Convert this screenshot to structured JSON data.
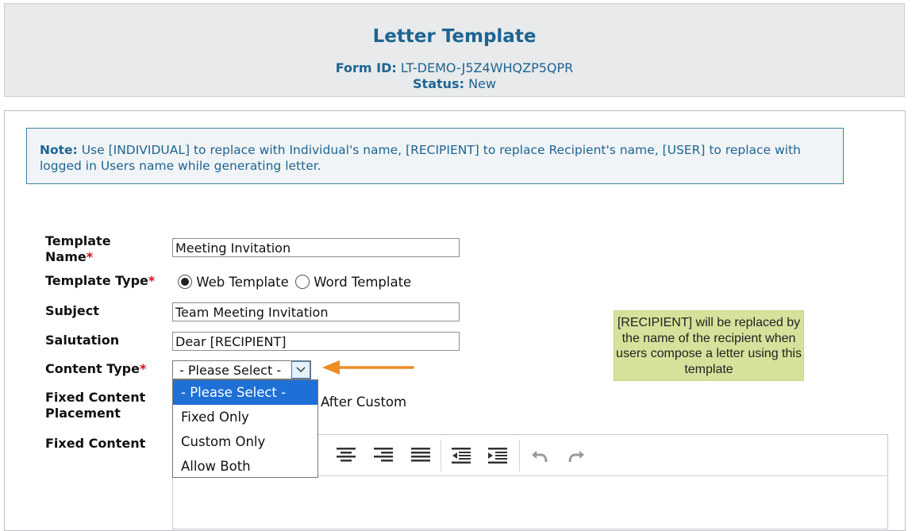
{
  "header": {
    "title": "Letter Template",
    "form_id_label": "Form ID:",
    "form_id_value": "LT-DEMO-J5Z4WHQZP5QPR",
    "status_label": "Status:",
    "status_value": "New"
  },
  "note": {
    "label": "Note:",
    "text": "Use [INDIVIDUAL] to replace with Individual's name, [RECIPIENT] to replace Recipient's name, [USER] to replace with logged in Users name while generating letter."
  },
  "form": {
    "template_name_label_1": "Template",
    "template_name_label_2": "Name",
    "template_name_value": "Meeting Invitation",
    "template_type_label": "Template Type",
    "template_type_options": [
      "Web Template",
      "Word Template"
    ],
    "template_type_selected": "Web Template",
    "subject_label": "Subject",
    "subject_value": "Team Meeting Invitation",
    "salutation_label": "Salutation",
    "salutation_value": "Dear [RECIPIENT]",
    "content_type_label": "Content Type",
    "content_type_selected": "- Please Select -",
    "content_type_options": [
      "- Please Select -",
      "Fixed Only",
      "Custom Only",
      "Allow Both"
    ],
    "fixed_content_placement_label_1": "Fixed Content",
    "fixed_content_placement_label_2": "Placement",
    "fixed_content_placement_visible_option": "After Custom",
    "fixed_content_label": "Fixed Content",
    "required_marker": "*"
  },
  "tooltip": {
    "text": "[RECIPIENT] will be replaced by the name of the recipient when users compose a letter using this template"
  },
  "editor_toolbar": {
    "icons": [
      "align-center-icon",
      "align-right-icon",
      "align-justify-icon",
      "outdent-icon",
      "indent-icon",
      "undo-icon",
      "redo-icon"
    ]
  },
  "colors": {
    "accent": "#1e6492",
    "required": "#d0111b",
    "dropdown_highlight": "#1e6fd6",
    "tooltip_bg": "#d5e29b",
    "pointer_arrow": "#f08a24"
  }
}
